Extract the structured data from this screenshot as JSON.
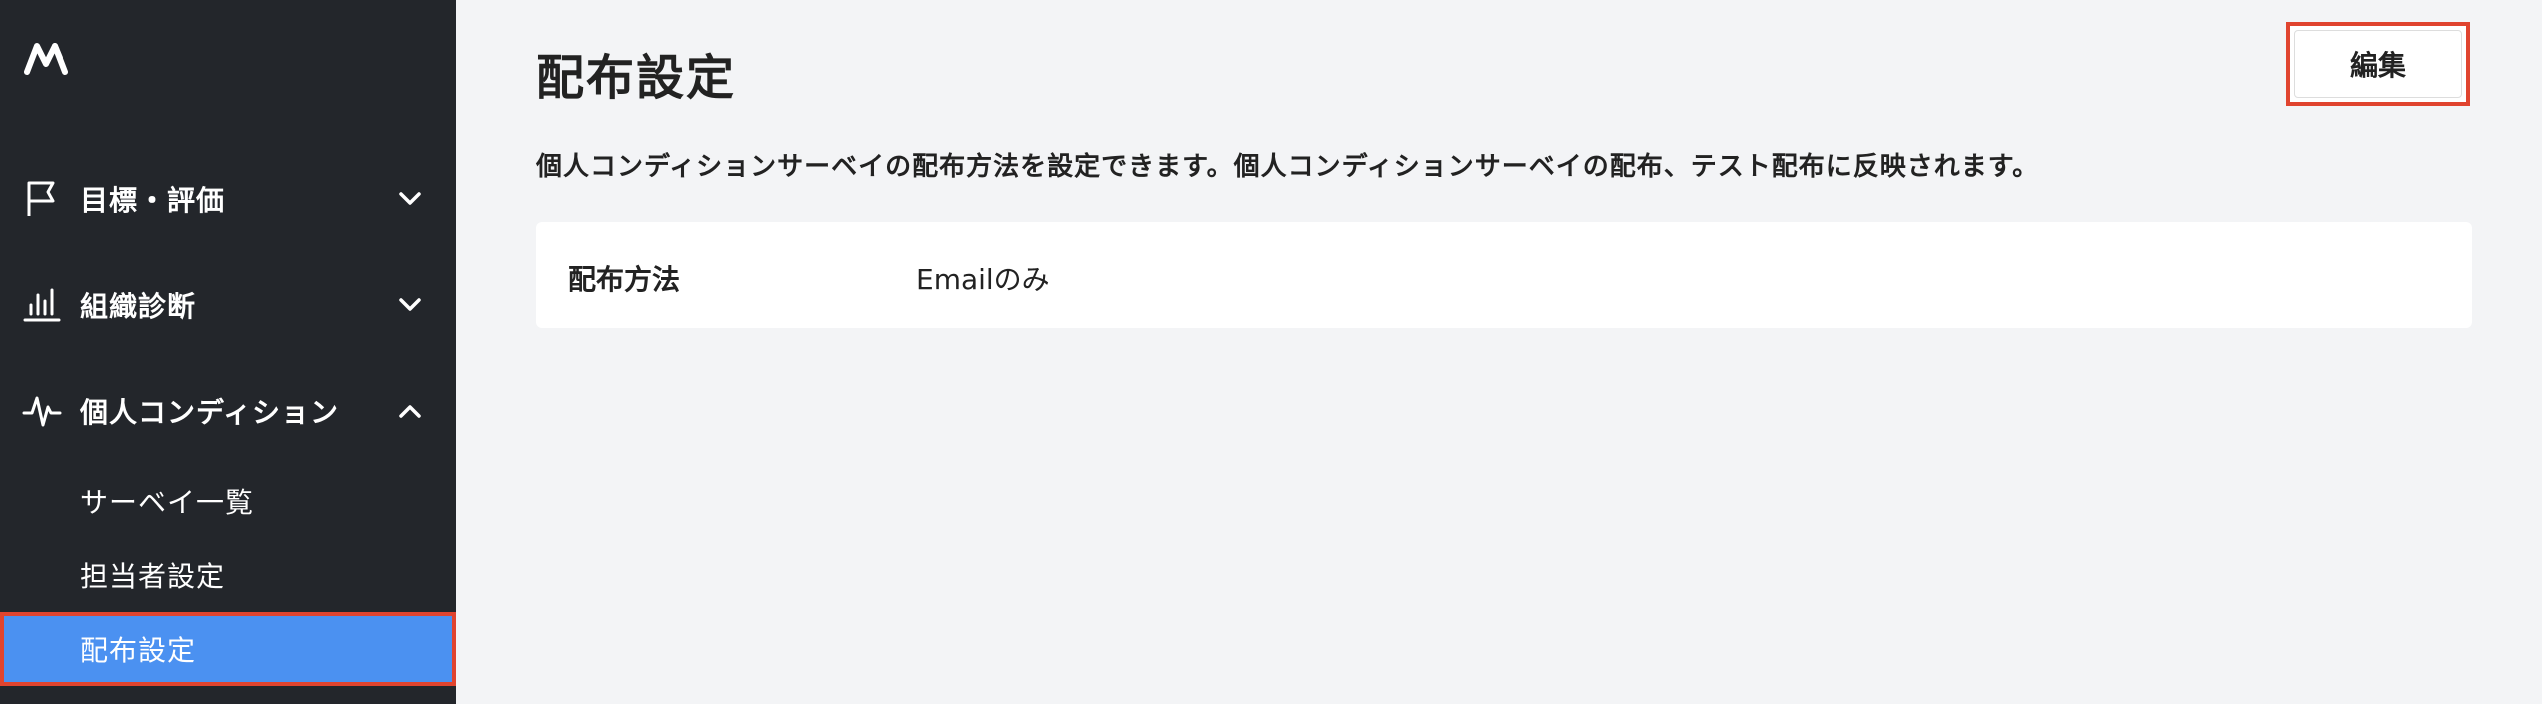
{
  "sidebar": {
    "logo_icon": "brand-logo-icon",
    "items": [
      {
        "label": "目標・評価",
        "icon": "flag-icon",
        "expanded": false
      },
      {
        "label": "組織診断",
        "icon": "bar-chart-icon",
        "expanded": false
      },
      {
        "label": "個人コンディション",
        "icon": "pulse-icon",
        "expanded": true
      }
    ],
    "sub_items": [
      {
        "label": "サーベイ一覧"
      },
      {
        "label": "担当者設定"
      },
      {
        "label": "配布設定",
        "active": true
      }
    ]
  },
  "main": {
    "title": "配布設定",
    "edit_label": "編集",
    "description": "個人コンディションサーベイの配布方法を設定できます。個人コンディションサーベイの配布、テスト配布に反映されます。",
    "setting": {
      "label": "配布方法",
      "value": "Emailのみ"
    }
  },
  "colors": {
    "sidebar_bg": "#23262b",
    "active_bg": "#4b91f1",
    "highlight_border": "#e0442f",
    "page_bg": "#f3f4f6"
  }
}
